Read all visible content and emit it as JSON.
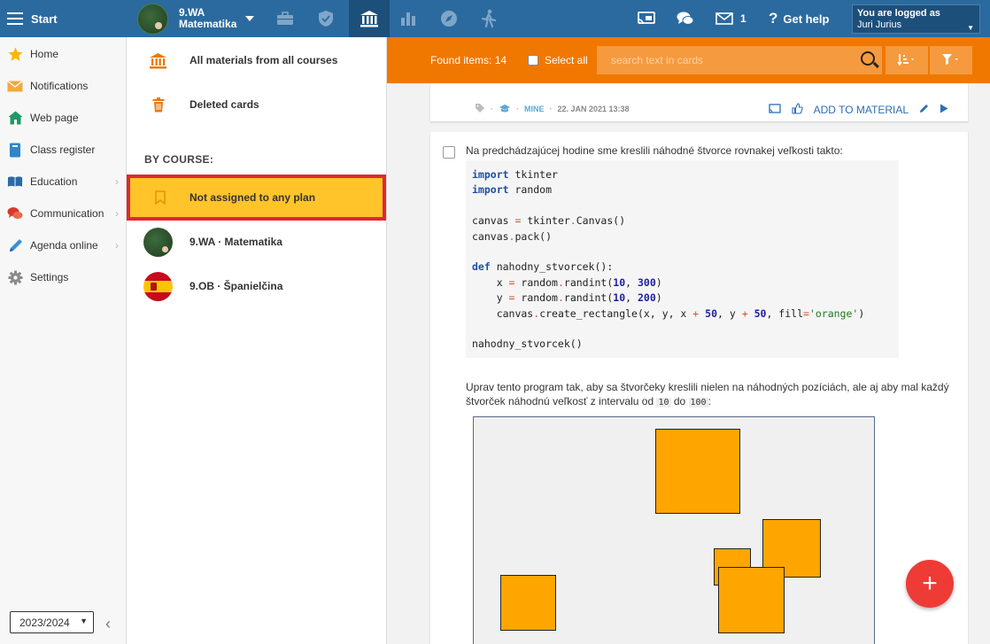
{
  "topbar": {
    "start_label": "Start",
    "course_line1": "9.WA",
    "course_line2": "Matematika",
    "help_label": "Get help",
    "messages_count": "1",
    "logged_label": "You are logged as",
    "user_name": "Juri Jurius",
    "icons": [
      "briefcase-icon",
      "shield-icon",
      "bank-icon",
      "bar-chart-icon",
      "compass-icon",
      "walking-icon",
      "cast-icon",
      "chat-icon",
      "mail-icon",
      "question-icon"
    ]
  },
  "leftnav": {
    "items": [
      {
        "label": "Home",
        "icon": "star-icon"
      },
      {
        "label": "Notifications",
        "icon": "envelope-icon"
      },
      {
        "label": "Web page",
        "icon": "house-icon"
      },
      {
        "label": "Class register",
        "icon": "phone-book-icon"
      },
      {
        "label": "Education",
        "icon": "book-icon"
      },
      {
        "label": "Communication",
        "icon": "speech-icon"
      },
      {
        "label": "Agenda online",
        "icon": "pencil-icon"
      },
      {
        "label": "Settings",
        "icon": "gear-icon"
      }
    ],
    "year": "2023/2024"
  },
  "midcol": {
    "all_materials": "All materials from all courses",
    "deleted_cards": "Deleted cards",
    "by_course": "BY COURSE:",
    "not_assigned": "Not assigned to any plan",
    "courses": [
      {
        "label": "9.WA · Matematika"
      },
      {
        "label": "9.OB · Španielčina"
      }
    ]
  },
  "filterbar": {
    "found_items": "Found items: 14",
    "select_all": "Select all",
    "search_placeholder": "search text in cards"
  },
  "card_top": {
    "mine": "MINE",
    "date": "22. JAN 2021 13:38",
    "add_to_material": "ADD TO MATERIAL"
  },
  "card_main": {
    "intro": "Na predchádzajúcej hodine sme kreslili náhodné štvorce rovnakej veľkosti takto:",
    "task_part1": "Uprav tento program tak, aby sa štvorčeky kreslili nielen na náhodných pozíciách, ale aj aby mal každý štvorček náhodnú veľkosť z intervalu od ",
    "task_from": "10",
    "task_and": " do ",
    "task_to": "100",
    "task_end": ":",
    "code_lines": [
      "import tkinter",
      "import random",
      "",
      "canvas = tkinter.Canvas()",
      "canvas.pack()",
      "",
      "def nahodny_stvorcek():",
      "    x = random.randint(10, 300)",
      "    y = random.randint(10, 200)",
      "    canvas.create_rectangle(x, y, x + 50, y + 50, fill='orange')",
      "",
      "nahodny_stvorcek()"
    ]
  },
  "fab_label": "+"
}
